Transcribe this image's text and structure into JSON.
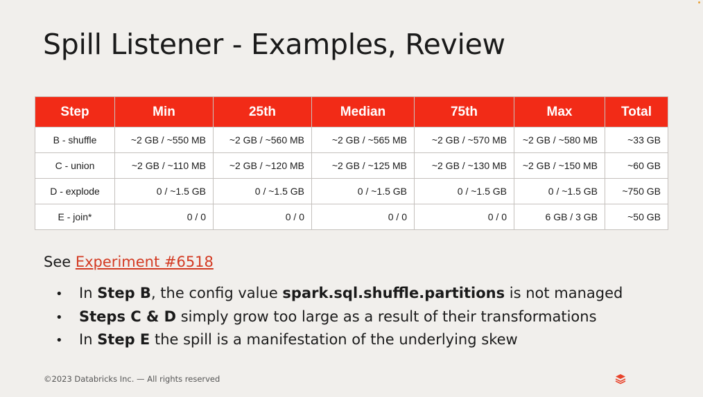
{
  "title": "Spill Listener - Examples, Review",
  "table": {
    "headers": [
      "Step",
      "Min",
      "25th",
      "Median",
      "75th",
      "Max",
      "Total"
    ],
    "rows": [
      [
        "B - shuffle",
        "~2 GB / ~550 MB",
        "~2 GB / ~560 MB",
        "~2 GB / ~565 MB",
        "~2 GB / ~570 MB",
        "~2 GB / ~580 MB",
        "~33 GB"
      ],
      [
        "C - union",
        "~2 GB / ~110 MB",
        "~2 GB / ~120 MB",
        "~2 GB / ~125 MB",
        "~2 GB / ~130 MB",
        "~2 GB / ~150 MB",
        "~60 GB"
      ],
      [
        "D - explode",
        "0 / ~1.5 GB",
        "0 / ~1.5 GB",
        "0 / ~1.5 GB",
        "0 / ~1.5 GB",
        "0 / ~1.5 GB",
        "~750 GB"
      ],
      [
        "E - join*",
        "0 / 0",
        "0 / 0",
        "0 / 0",
        "0 / 0",
        "6 GB / 3 GB",
        "~50 GB"
      ]
    ]
  },
  "see": {
    "prefix": "See ",
    "link_text": "Experiment #6518"
  },
  "bullets": [
    [
      {
        "t": "In ",
        "b": false
      },
      {
        "t": "Step B",
        "b": true
      },
      {
        "t": ", the config value ",
        "b": false
      },
      {
        "t": "spark.sql.shuffle.partitions",
        "b": true
      },
      {
        "t": " is not managed",
        "b": false
      }
    ],
    [
      {
        "t": "Steps C & D",
        "b": true
      },
      {
        "t": " simply grow too large as a result of their transformations",
        "b": false
      }
    ],
    [
      {
        "t": "In ",
        "b": false
      },
      {
        "t": "Step E",
        "b": true
      },
      {
        "t": "  the spill is a manifestation of the underlying skew",
        "b": false
      }
    ]
  ],
  "footer": "©2023 Databricks Inc. — All rights reserved",
  "icons": {
    "logo": "databricks-logo-icon",
    "bullet": "•"
  },
  "colors": {
    "header_bg": "#f22b17",
    "link": "#d33a22",
    "background": "#f1efec"
  }
}
